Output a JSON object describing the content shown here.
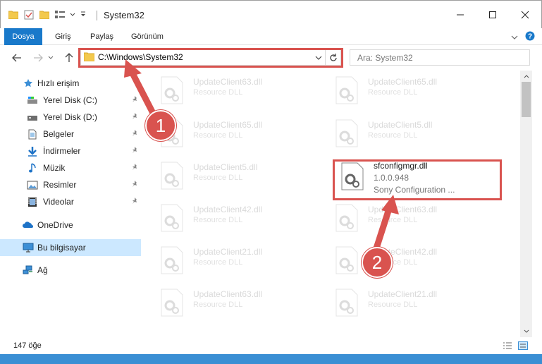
{
  "window": {
    "title": "System32"
  },
  "ribbon": {
    "tabs": [
      "Dosya",
      "Giriş",
      "Paylaş",
      "Görünüm"
    ]
  },
  "address": {
    "path": "C:\\Windows\\System32"
  },
  "search": {
    "placeholder": "Ara: System32"
  },
  "sidebar": {
    "items": [
      {
        "label": "Hızlı erişim",
        "icon": "star-icon"
      },
      {
        "label": "Yerel Disk (C:)",
        "icon": "drive-icon"
      },
      {
        "label": "Yerel Disk (D:)",
        "icon": "drive-icon"
      },
      {
        "label": "Belgeler",
        "icon": "document-icon"
      },
      {
        "label": "İndirmeler",
        "icon": "download-icon"
      },
      {
        "label": "Müzik",
        "icon": "music-icon"
      },
      {
        "label": "Resimler",
        "icon": "pictures-icon"
      },
      {
        "label": "Videolar",
        "icon": "video-icon"
      },
      {
        "label": "OneDrive",
        "icon": "cloud-icon"
      },
      {
        "label": "Bu bilgisayar",
        "icon": "computer-icon"
      },
      {
        "label": "Ağ",
        "icon": "network-icon"
      }
    ]
  },
  "files": [
    {
      "name": "UpdateClient63.dll",
      "type": "Resource DLL"
    },
    {
      "name": "UpdateClient65.dll",
      "type": "Resource DLL"
    },
    {
      "name": "UpdateClient65.dll",
      "type": "Resource DLL"
    },
    {
      "name": "UpdateClient5.dll",
      "type": "Resource DLL"
    },
    {
      "name": "UpdateClient5.dll",
      "type": "Resource DLL"
    },
    {
      "name": "sfconfigmgr.dll",
      "version": "1.0.0.948",
      "description": "Sony Configuration ..."
    },
    {
      "name": "UpdateClient42.dll",
      "type": "Resource DLL"
    },
    {
      "name": "UpdateClient63.dll",
      "type": "Resource DLL"
    },
    {
      "name": "UpdateClient21.dll",
      "type": "Resource DLL"
    },
    {
      "name": "UpdateClient42.dll",
      "type": "Resource DLL"
    },
    {
      "name": "UpdateClient63.dll",
      "type": "Resource DLL"
    },
    {
      "name": "UpdateClient21.dll",
      "type": "Resource DLL"
    }
  ],
  "status": {
    "item_count": "147 öğe"
  },
  "callouts": {
    "one": "1",
    "two": "2"
  },
  "colors": {
    "accent": "#1979ca",
    "highlight": "#d9534f",
    "selected": "#cce8ff"
  }
}
